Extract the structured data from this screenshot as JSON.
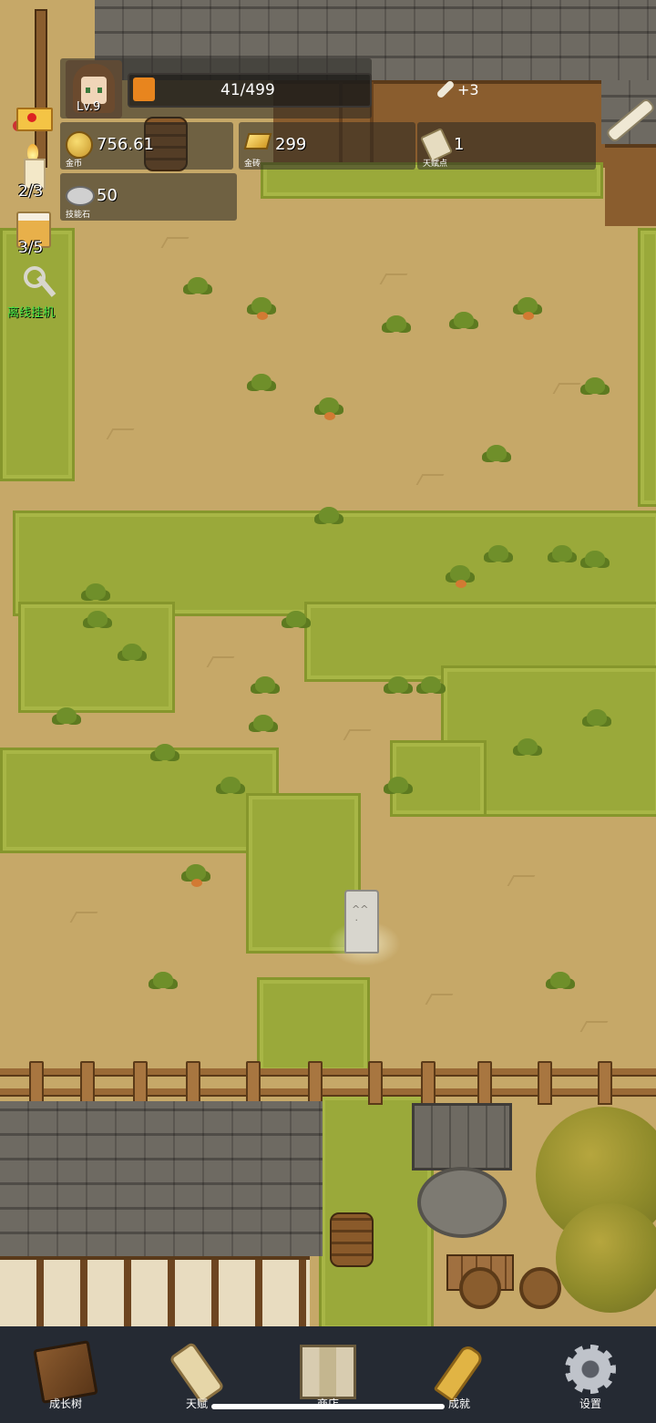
{
  "player": {
    "level_label": "Lv.9"
  },
  "xp": {
    "text": "41/499",
    "bonus": "+3",
    "fill_fraction": 0.082
  },
  "resources": [
    {
      "id": "gold-coin",
      "value": "756.61",
      "caption": "金币",
      "icon": "gold-coin-icon"
    },
    {
      "id": "gold-brick",
      "value": "299",
      "caption": "金砖",
      "icon": "gold-bar-icon"
    },
    {
      "id": "talent-points",
      "value": "1",
      "caption": "天赋点",
      "icon": "scroll-icon"
    },
    {
      "id": "skill-stone",
      "value": "50",
      "caption": "技能石",
      "icon": "stone-icon"
    }
  ],
  "side": {
    "candle_count": "2/3",
    "beer_count": "3/5",
    "idle_label": "离线挂机"
  },
  "nav": [
    {
      "label": "成长树",
      "icon": "book-icon"
    },
    {
      "label": "天赋",
      "icon": "scroll-icon"
    },
    {
      "label": "商店",
      "icon": "map-icon"
    },
    {
      "label": "成就",
      "icon": "key-icon"
    },
    {
      "label": "设置",
      "icon": "gear-icon"
    }
  ],
  "colors": {
    "xp_fill": "#e8851e",
    "idle_label": "#43e043",
    "nav_bg": "#252a33"
  }
}
